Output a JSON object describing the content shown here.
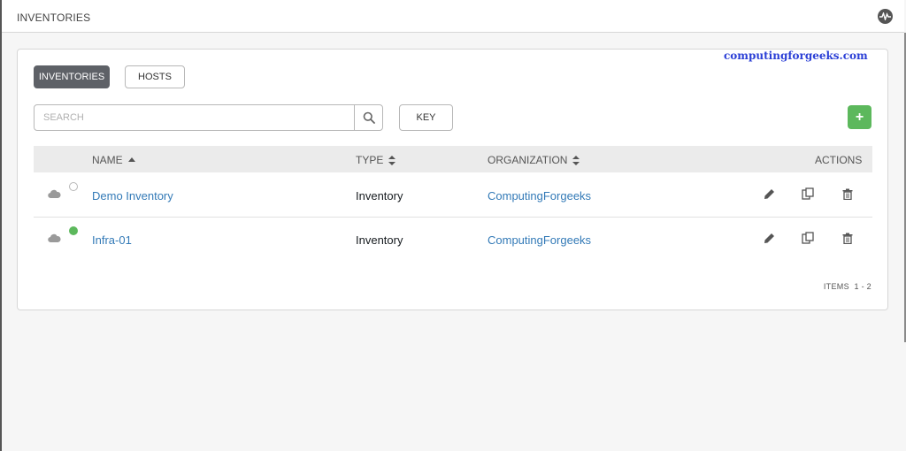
{
  "header": {
    "title": "INVENTORIES",
    "activity_icon": "activity-stream-icon"
  },
  "watermark": "computingforgeeks.com",
  "tabs": [
    {
      "label": "INVENTORIES",
      "active": true
    },
    {
      "label": "HOSTS",
      "active": false
    }
  ],
  "search": {
    "placeholder": "SEARCH",
    "value": ""
  },
  "key_button": "KEY",
  "add_button": "+",
  "table": {
    "columns": {
      "name": "NAME",
      "type": "TYPE",
      "organization": "ORGANIZATION",
      "actions": "ACTIONS"
    },
    "rows": [
      {
        "name": "Demo Inventory",
        "type": "Inventory",
        "organization": "ComputingForgeeks",
        "status": "none"
      },
      {
        "name": "Infra-01",
        "type": "Inventory",
        "organization": "ComputingForgeeks",
        "status": "success"
      }
    ]
  },
  "pagination": {
    "label": "ITEMS  1 - 2"
  },
  "colors": {
    "accent": "#337ab7",
    "success": "#5cb85c",
    "tab_active": "#5e6167",
    "header_bg": "#ebebeb"
  }
}
